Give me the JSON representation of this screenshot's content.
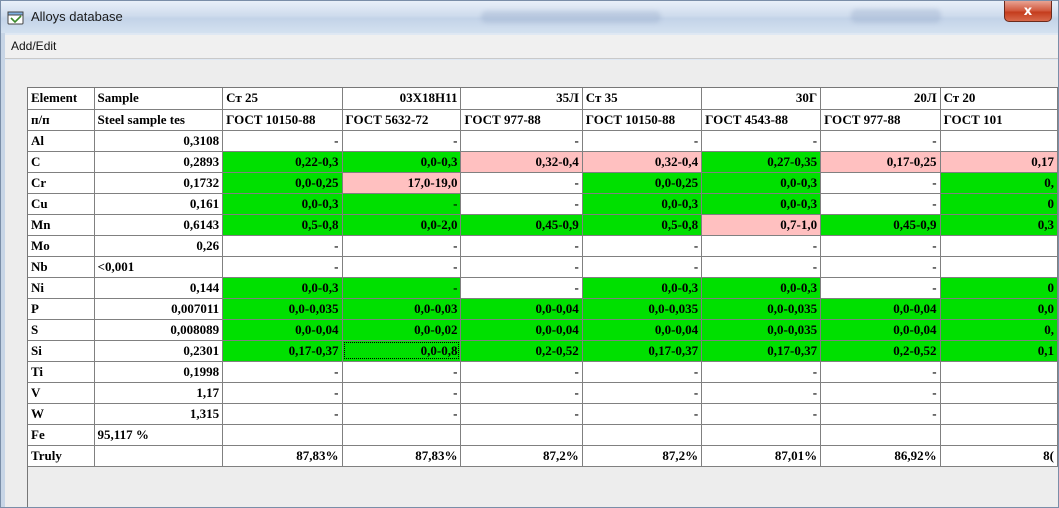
{
  "window": {
    "title": "Alloys database"
  },
  "menu": {
    "items": [
      "Add/Edit"
    ]
  },
  "grid": {
    "header_row1": [
      "Element",
      "Sample",
      "Ст 25",
      "03Х18Н11",
      "35Л",
      "Ст 35",
      "30Г",
      "20Л",
      "Ст 20"
    ],
    "header_row2": [
      "п/п",
      "Steel sample tes",
      "ГОСТ 10150-88",
      "ГОСТ 5632-72",
      "ГОСТ 977-88",
      "ГОСТ 10150-88",
      "ГОСТ 4543-88",
      "ГОСТ 977-88",
      "ГОСТ 101"
    ],
    "rows": [
      {
        "element": "Al",
        "sample": "0,3108",
        "cells": [
          {
            "v": "-",
            "c": ""
          },
          {
            "v": "-",
            "c": ""
          },
          {
            "v": "-",
            "c": ""
          },
          {
            "v": "-",
            "c": ""
          },
          {
            "v": "-",
            "c": ""
          },
          {
            "v": "-",
            "c": ""
          },
          {
            "v": "",
            "c": ""
          }
        ]
      },
      {
        "element": "C",
        "sample": "0,2893",
        "cells": [
          {
            "v": "0,22-0,3",
            "c": "green"
          },
          {
            "v": "0,0-0,3",
            "c": "green"
          },
          {
            "v": "0,32-0,4",
            "c": "pink"
          },
          {
            "v": "0,32-0,4",
            "c": "pink"
          },
          {
            "v": "0,27-0,35",
            "c": "green"
          },
          {
            "v": "0,17-0,25",
            "c": "pink"
          },
          {
            "v": "0,17",
            "c": "pink"
          }
        ]
      },
      {
        "element": "Cr",
        "sample": "0,1732",
        "cells": [
          {
            "v": "0,0-0,25",
            "c": "green"
          },
          {
            "v": "17,0-19,0",
            "c": "pink"
          },
          {
            "v": "-",
            "c": ""
          },
          {
            "v": "0,0-0,25",
            "c": "green"
          },
          {
            "v": "0,0-0,3",
            "c": "green"
          },
          {
            "v": "-",
            "c": ""
          },
          {
            "v": "0,",
            "c": "green"
          }
        ]
      },
      {
        "element": "Cu",
        "sample": "0,161",
        "cells": [
          {
            "v": "0,0-0,3",
            "c": "green"
          },
          {
            "v": "-",
            "c": "green"
          },
          {
            "v": "-",
            "c": ""
          },
          {
            "v": "0,0-0,3",
            "c": "green"
          },
          {
            "v": "0,0-0,3",
            "c": "green"
          },
          {
            "v": "-",
            "c": ""
          },
          {
            "v": "0",
            "c": "green"
          }
        ]
      },
      {
        "element": "Mn",
        "sample": "0,6143",
        "cells": [
          {
            "v": "0,5-0,8",
            "c": "green"
          },
          {
            "v": "0,0-2,0",
            "c": "green"
          },
          {
            "v": "0,45-0,9",
            "c": "green"
          },
          {
            "v": "0,5-0,8",
            "c": "green"
          },
          {
            "v": "0,7-1,0",
            "c": "pink"
          },
          {
            "v": "0,45-0,9",
            "c": "green"
          },
          {
            "v": "0,3",
            "c": "green"
          }
        ]
      },
      {
        "element": "Mo",
        "sample": "0,26",
        "cells": [
          {
            "v": "-",
            "c": ""
          },
          {
            "v": "-",
            "c": ""
          },
          {
            "v": "-",
            "c": ""
          },
          {
            "v": "-",
            "c": ""
          },
          {
            "v": "-",
            "c": ""
          },
          {
            "v": "-",
            "c": ""
          },
          {
            "v": "",
            "c": ""
          }
        ]
      },
      {
        "element": "Nb",
        "sample": "<0,001",
        "sample_align": "left",
        "cells": [
          {
            "v": "-",
            "c": ""
          },
          {
            "v": "-",
            "c": ""
          },
          {
            "v": "-",
            "c": ""
          },
          {
            "v": "-",
            "c": ""
          },
          {
            "v": "-",
            "c": ""
          },
          {
            "v": "-",
            "c": ""
          },
          {
            "v": "",
            "c": ""
          }
        ]
      },
      {
        "element": "Ni",
        "sample": "0,144",
        "cells": [
          {
            "v": "0,0-0,3",
            "c": "green"
          },
          {
            "v": "-",
            "c": "green"
          },
          {
            "v": "-",
            "c": ""
          },
          {
            "v": "0,0-0,3",
            "c": "green"
          },
          {
            "v": "0,0-0,3",
            "c": "green"
          },
          {
            "v": "-",
            "c": ""
          },
          {
            "v": "0",
            "c": "green"
          }
        ]
      },
      {
        "element": "P",
        "sample": "0,007011",
        "cells": [
          {
            "v": "0,0-0,035",
            "c": "green"
          },
          {
            "v": "0,0-0,03",
            "c": "green"
          },
          {
            "v": "0,0-0,04",
            "c": "green"
          },
          {
            "v": "0,0-0,035",
            "c": "green"
          },
          {
            "v": "0,0-0,035",
            "c": "green"
          },
          {
            "v": "0,0-0,04",
            "c": "green"
          },
          {
            "v": "0,0",
            "c": "green"
          }
        ]
      },
      {
        "element": "S",
        "sample": "0,008089",
        "cells": [
          {
            "v": "0,0-0,04",
            "c": "green"
          },
          {
            "v": "0,0-0,02",
            "c": "green"
          },
          {
            "v": "0,0-0,04",
            "c": "green"
          },
          {
            "v": "0,0-0,04",
            "c": "green"
          },
          {
            "v": "0,0-0,035",
            "c": "green"
          },
          {
            "v": "0,0-0,04",
            "c": "green"
          },
          {
            "v": "0,",
            "c": "green"
          }
        ]
      },
      {
        "element": "Si",
        "sample": "0,2301",
        "cells": [
          {
            "v": "0,17-0,37",
            "c": "green"
          },
          {
            "v": "0,0-0,8",
            "c": "green",
            "selected": true
          },
          {
            "v": "0,2-0,52",
            "c": "green"
          },
          {
            "v": "0,17-0,37",
            "c": "green"
          },
          {
            "v": "0,17-0,37",
            "c": "green"
          },
          {
            "v": "0,2-0,52",
            "c": "green"
          },
          {
            "v": "0,1",
            "c": "green"
          }
        ]
      },
      {
        "element": "Ti",
        "sample": "0,1998",
        "cells": [
          {
            "v": "-",
            "c": ""
          },
          {
            "v": "-",
            "c": ""
          },
          {
            "v": "-",
            "c": ""
          },
          {
            "v": "-",
            "c": ""
          },
          {
            "v": "-",
            "c": ""
          },
          {
            "v": "-",
            "c": ""
          },
          {
            "v": "",
            "c": ""
          }
        ]
      },
      {
        "element": "V",
        "sample": "1,17",
        "cells": [
          {
            "v": "-",
            "c": ""
          },
          {
            "v": "-",
            "c": ""
          },
          {
            "v": "-",
            "c": ""
          },
          {
            "v": "-",
            "c": ""
          },
          {
            "v": "-",
            "c": ""
          },
          {
            "v": "-",
            "c": ""
          },
          {
            "v": "",
            "c": ""
          }
        ]
      },
      {
        "element": "W",
        "sample": "1,315",
        "cells": [
          {
            "v": "-",
            "c": ""
          },
          {
            "v": "-",
            "c": ""
          },
          {
            "v": "-",
            "c": ""
          },
          {
            "v": "-",
            "c": ""
          },
          {
            "v": "-",
            "c": ""
          },
          {
            "v": "-",
            "c": ""
          },
          {
            "v": "",
            "c": ""
          }
        ]
      },
      {
        "element": "Fe",
        "sample": "95,117 %",
        "sample_align": "left",
        "cells": [
          {
            "v": "",
            "c": ""
          },
          {
            "v": "",
            "c": ""
          },
          {
            "v": "",
            "c": ""
          },
          {
            "v": "",
            "c": ""
          },
          {
            "v": "",
            "c": ""
          },
          {
            "v": "",
            "c": ""
          },
          {
            "v": "",
            "c": ""
          }
        ]
      },
      {
        "element": "Truly",
        "sample": "",
        "cells": [
          {
            "v": "87,83%",
            "c": ""
          },
          {
            "v": "87,83%",
            "c": ""
          },
          {
            "v": "87,2%",
            "c": ""
          },
          {
            "v": "87,2%",
            "c": ""
          },
          {
            "v": "87,01%",
            "c": ""
          },
          {
            "v": "86,92%",
            "c": ""
          },
          {
            "v": "8(",
            "c": ""
          }
        ]
      }
    ],
    "colors": {
      "green": "#00e000",
      "pink": "#ffc0c0",
      "fixed": "#f0f0f0"
    }
  },
  "icons": {
    "app": "database-window-icon",
    "close": "close-icon"
  },
  "close_glyph": "x"
}
